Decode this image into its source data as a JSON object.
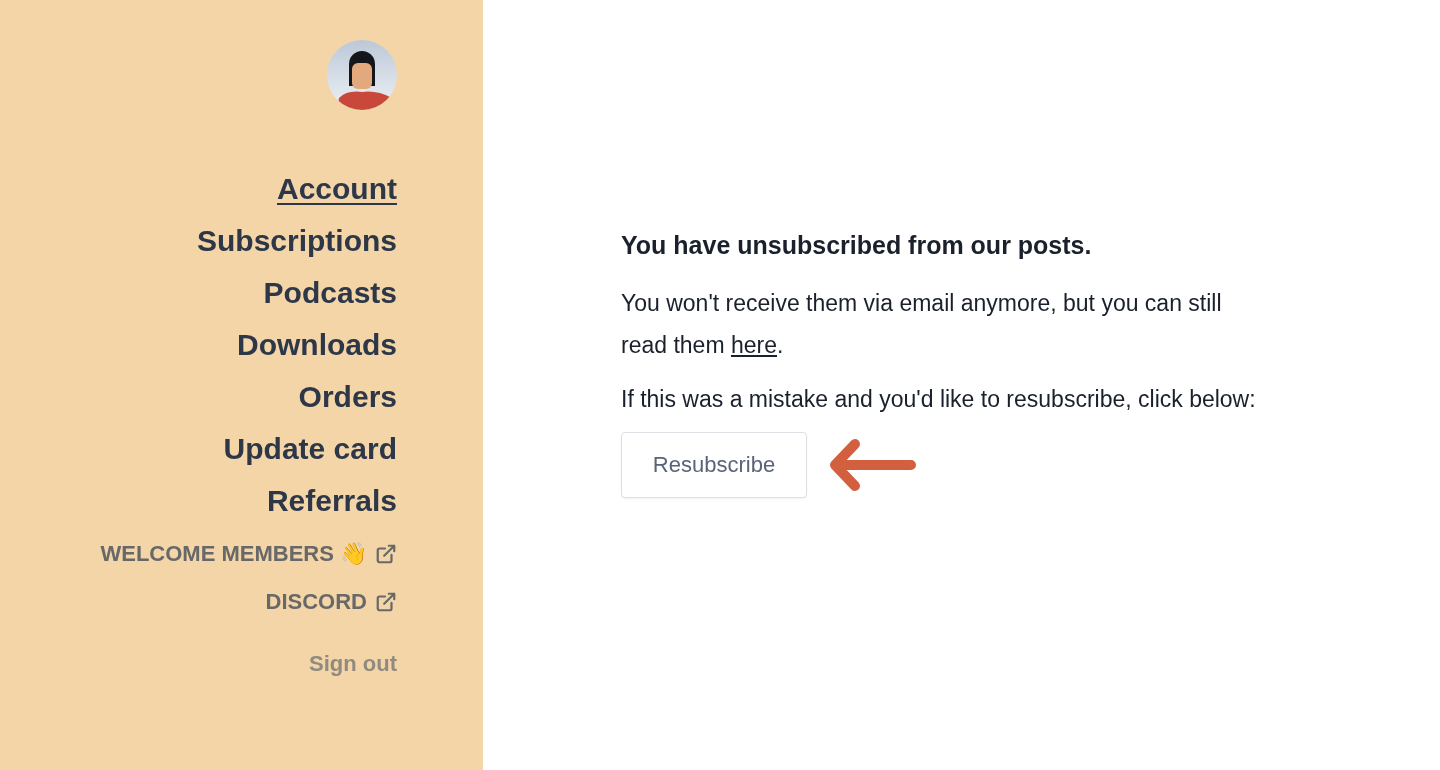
{
  "sidebar": {
    "nav_items": [
      {
        "label": "Account",
        "selected": true
      },
      {
        "label": "Subscriptions",
        "selected": false
      },
      {
        "label": "Podcasts",
        "selected": false
      },
      {
        "label": "Downloads",
        "selected": false
      },
      {
        "label": "Orders",
        "selected": false
      },
      {
        "label": "Update card",
        "selected": false
      },
      {
        "label": "Referrals",
        "selected": false
      }
    ],
    "external_links": [
      {
        "label": "WELCOME MEMBERS 👋"
      },
      {
        "label": "DISCORD"
      }
    ],
    "sign_out": "Sign out"
  },
  "main": {
    "heading": "You have unsubscribed from our posts.",
    "message": {
      "before": "You won't receive them via email anymore, but you can still read them ",
      "link": "here",
      "after": "."
    },
    "prompt": "If this was a mistake and you'd like to resubscribe, click below:",
    "button": "Resubscribe"
  }
}
